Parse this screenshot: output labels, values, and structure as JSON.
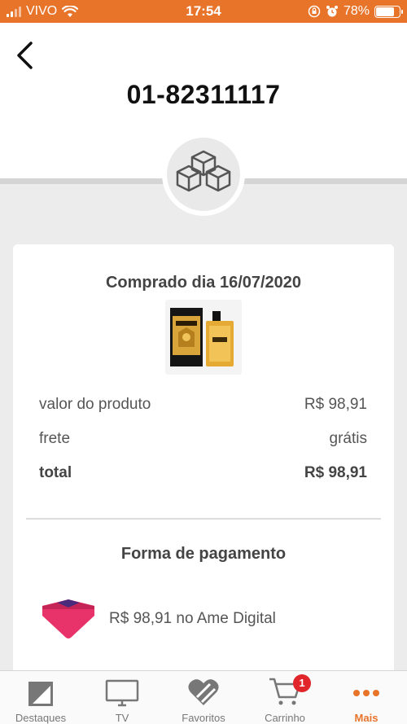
{
  "status_bar": {
    "carrier": "VIVO",
    "time": "17:54",
    "battery_percent": "78%",
    "battery_level": 0.78,
    "icons": [
      "signal-icon",
      "wifi-icon",
      "rotation-lock-icon",
      "alarm-icon",
      "battery-icon"
    ]
  },
  "header": {
    "order_id": "01-82311117",
    "back_icon": "chevron-left-icon",
    "status_icon": "boxes-icon"
  },
  "purchase": {
    "date_label": "Comprado dia 16/07/2020",
    "product_image": "perfume-product-image",
    "rows": [
      {
        "label": "valor do produto",
        "value": "R$ 98,91"
      },
      {
        "label": "frete",
        "value": "grátis"
      },
      {
        "label": "total",
        "value": "R$ 98,91"
      }
    ]
  },
  "payment": {
    "title": "Forma de pagamento",
    "method_text": "R$ 98,91 no Ame Digital",
    "method_icon": "ame-digital-icon"
  },
  "tab_bar": {
    "tabs": [
      {
        "label": "Destaques",
        "icon": "highlights-icon"
      },
      {
        "label": "TV",
        "icon": "tv-icon"
      },
      {
        "label": "Favoritos",
        "icon": "heart-icon"
      },
      {
        "label": "Carrinho",
        "icon": "cart-icon",
        "badge": "1"
      },
      {
        "label": "Mais",
        "icon": "more-icon"
      }
    ],
    "active_index": 4
  },
  "colors": {
    "brand_orange": "#e8742a",
    "badge_red": "#e0252b",
    "ame_pink": "#e8336a"
  }
}
